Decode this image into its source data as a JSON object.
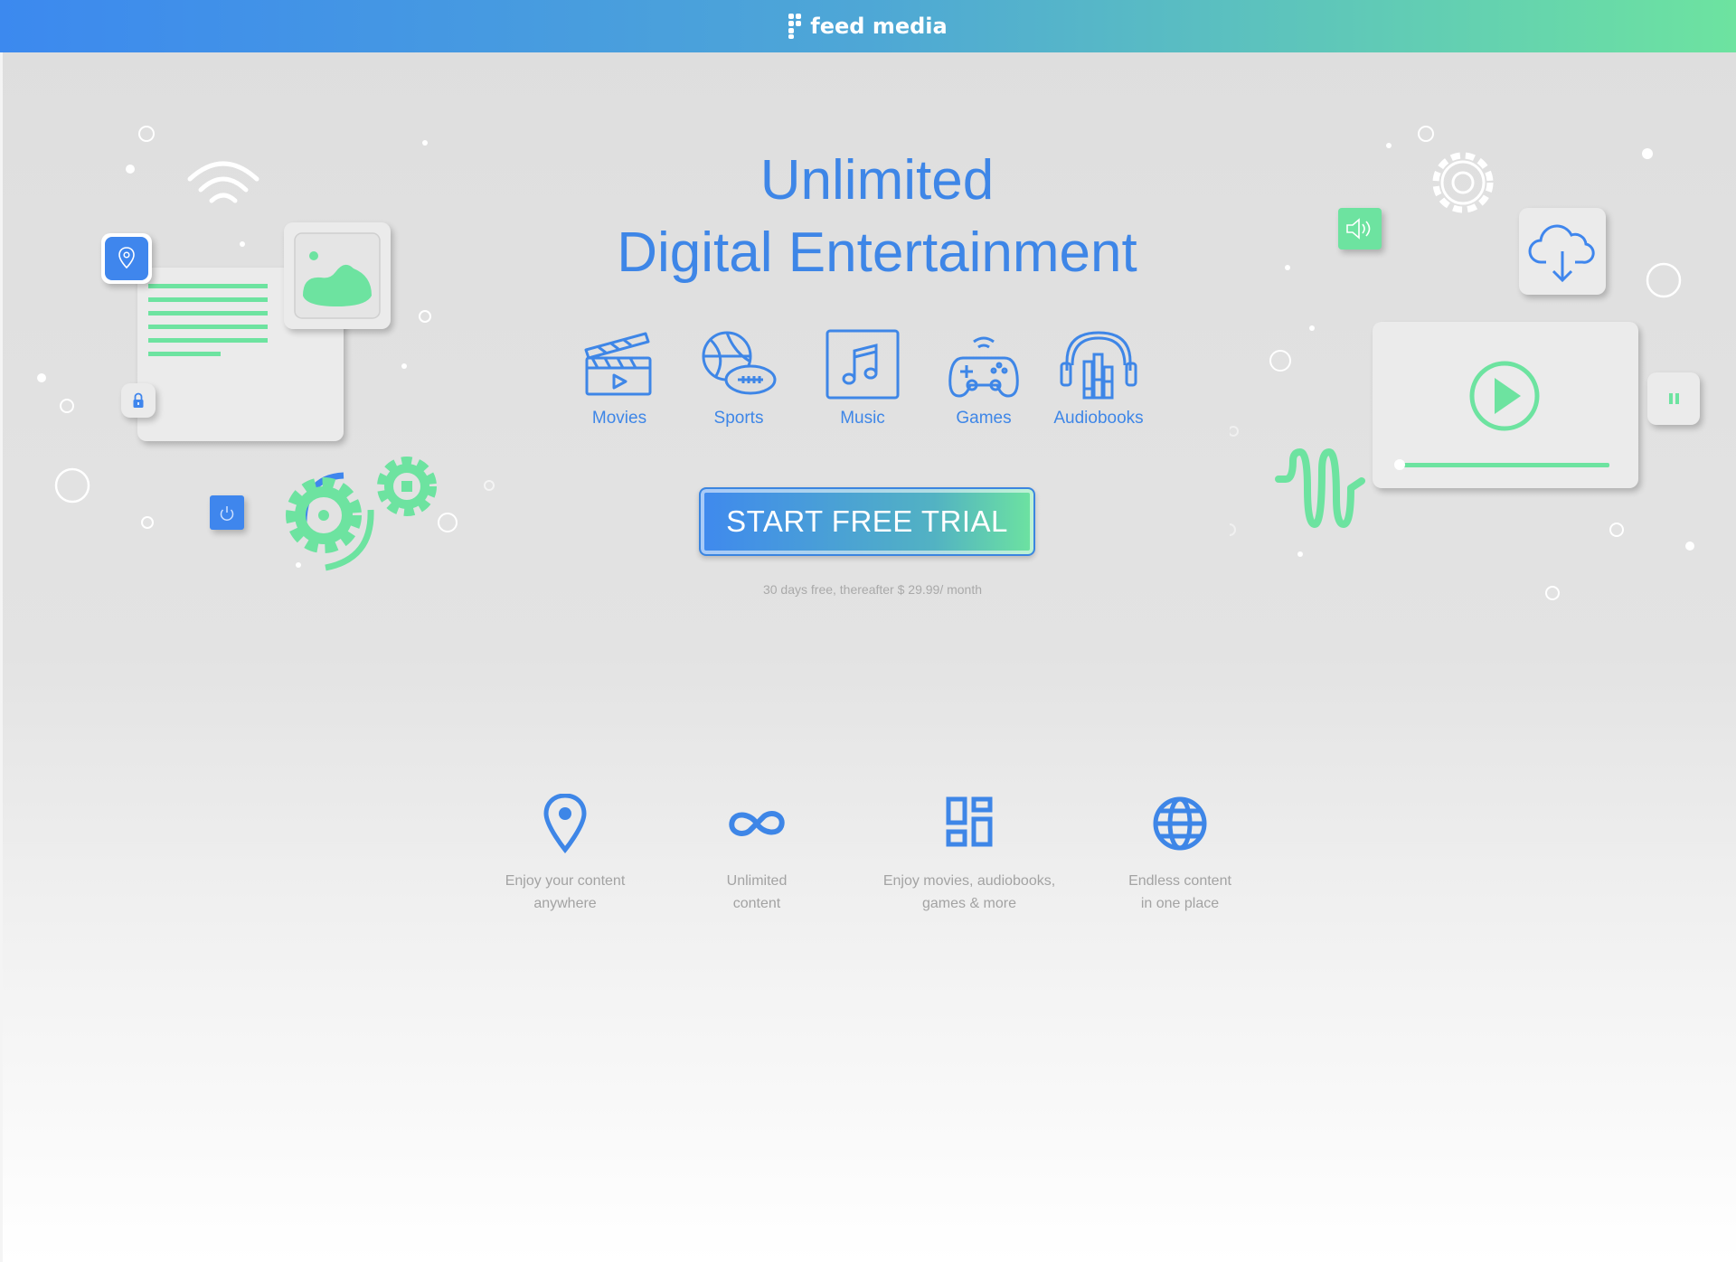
{
  "brand": {
    "name": "feed media",
    "icon": "brand-logo-icon"
  },
  "hero": {
    "title_line1": "Unlimited",
    "title_line2": "Digital Entertainment"
  },
  "categories": [
    {
      "label": "Movies",
      "icon": "clapperboard-icon"
    },
    {
      "label": "Sports",
      "icon": "sports-balls-icon"
    },
    {
      "label": "Music",
      "icon": "music-note-icon"
    },
    {
      "label": "Games",
      "icon": "gamepad-icon"
    },
    {
      "label": "Audiobooks",
      "icon": "headphones-books-icon"
    }
  ],
  "cta": {
    "label": "START FREE TRIAL",
    "note": "30 days free, thereafter $ 29.99/ month"
  },
  "features": [
    {
      "line1": "Enjoy your content",
      "line2": "anywhere",
      "icon": "location-pin-icon"
    },
    {
      "line1": "Unlimited",
      "line2": "content",
      "icon": "infinity-icon"
    },
    {
      "line1": "Enjoy movies, audiobooks,",
      "line2": "games & more",
      "icon": "dashboard-grid-icon"
    },
    {
      "line1": "Endless content",
      "line2": "in one place",
      "icon": "globe-icon"
    }
  ],
  "colors": {
    "primary": "#3e86e7",
    "accent": "#6de3a0",
    "muted": "#a3a3a3"
  }
}
